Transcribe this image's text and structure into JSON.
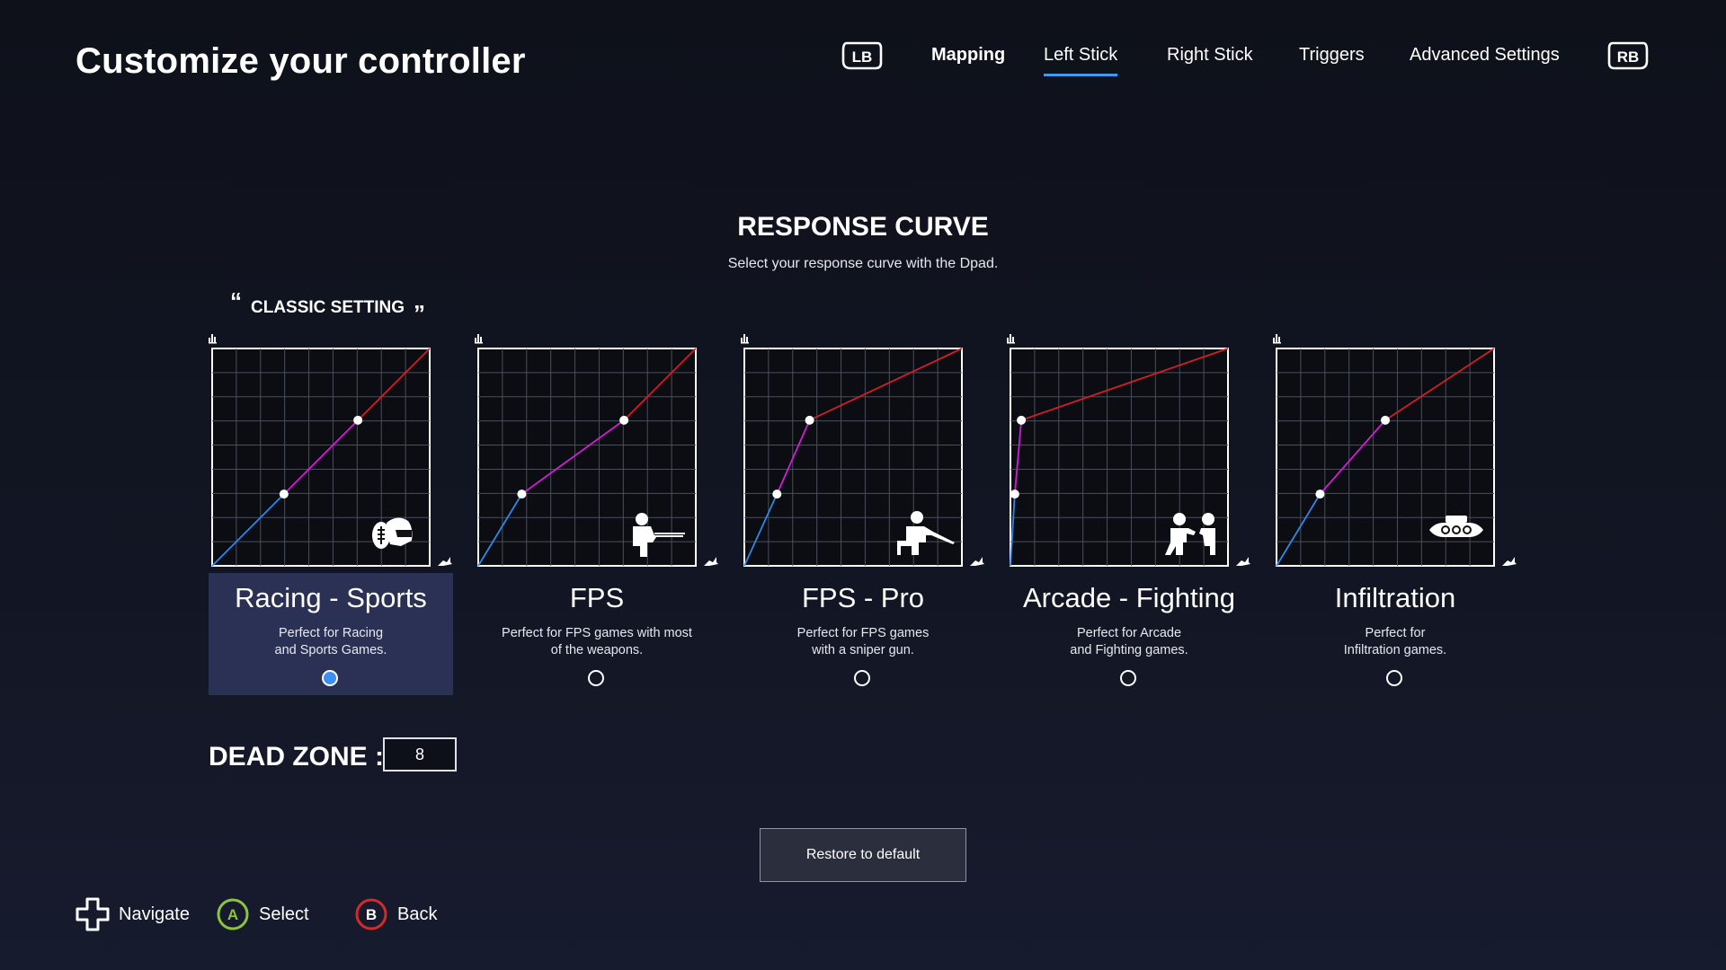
{
  "header": {
    "title": "Customize your controller"
  },
  "nav": {
    "left_bumper": "LB",
    "right_bumper": "RB",
    "tabs": [
      {
        "label": "Mapping"
      },
      {
        "label": "Left Stick"
      },
      {
        "label": "Right Stick"
      },
      {
        "label": "Triggers"
      },
      {
        "label": "Advanced Settings"
      }
    ],
    "active_tab": "Left Stick"
  },
  "section": {
    "title": "RESPONSE CURVE",
    "subtitle": "Select your response curve with the Dpad.",
    "classic_label": "CLASSIC SETTING",
    "quote_open": "“",
    "quote_close": "”"
  },
  "presets": [
    {
      "name": "Racing - Sports",
      "description": "Perfect for Racing\nand Sports Games.",
      "selected": true,
      "icon": "helmet-football-icon",
      "curve": [
        [
          0,
          0
        ],
        [
          0.33,
          0.33
        ],
        [
          0.67,
          0.67
        ],
        [
          1,
          1
        ]
      ]
    },
    {
      "name": "FPS",
      "description": "Perfect for FPS games with most\nof the weapons.",
      "selected": false,
      "icon": "soldier-rifle-icon",
      "curve": [
        [
          0,
          0
        ],
        [
          0.2,
          0.33
        ],
        [
          0.67,
          0.67
        ],
        [
          1,
          1
        ]
      ]
    },
    {
      "name": "FPS - Pro",
      "description": "Perfect for FPS games\nwith a sniper gun.",
      "selected": false,
      "icon": "sniper-icon",
      "curve": [
        [
          0,
          0
        ],
        [
          0.15,
          0.33
        ],
        [
          0.3,
          0.67
        ],
        [
          1,
          1
        ]
      ]
    },
    {
      "name": "Arcade - Fighting",
      "description": "Perfect for Arcade\nand Fighting games.",
      "selected": false,
      "icon": "fighters-icon",
      "curve": [
        [
          0,
          0
        ],
        [
          0.02,
          0.33
        ],
        [
          0.05,
          0.67
        ],
        [
          1,
          1
        ]
      ]
    },
    {
      "name": "Infiltration",
      "description": "Perfect for\nInfiltration games.",
      "selected": false,
      "icon": "night-vision-goggles-icon",
      "curve": [
        [
          0,
          0
        ],
        [
          0.2,
          0.33
        ],
        [
          0.5,
          0.67
        ],
        [
          1,
          1
        ]
      ]
    }
  ],
  "colors": {
    "accent": "#3d9bf0",
    "segment_low": "#2f86e6",
    "segment_mid": "#d21dd6",
    "segment_high": "#d11e2a",
    "selected_card": "#2b3154"
  },
  "dead_zone": {
    "label": "DEAD ZONE :",
    "value": "8"
  },
  "buttons": {
    "restore": "Restore to default"
  },
  "hints": [
    {
      "icon": "dpad-icon",
      "label": "Navigate"
    },
    {
      "icon": "a-button-icon",
      "label": "Select",
      "letter": "A",
      "color": "#8bc43f"
    },
    {
      "icon": "b-button-icon",
      "label": "Back",
      "letter": "B",
      "color": "#d42a2a"
    }
  ]
}
